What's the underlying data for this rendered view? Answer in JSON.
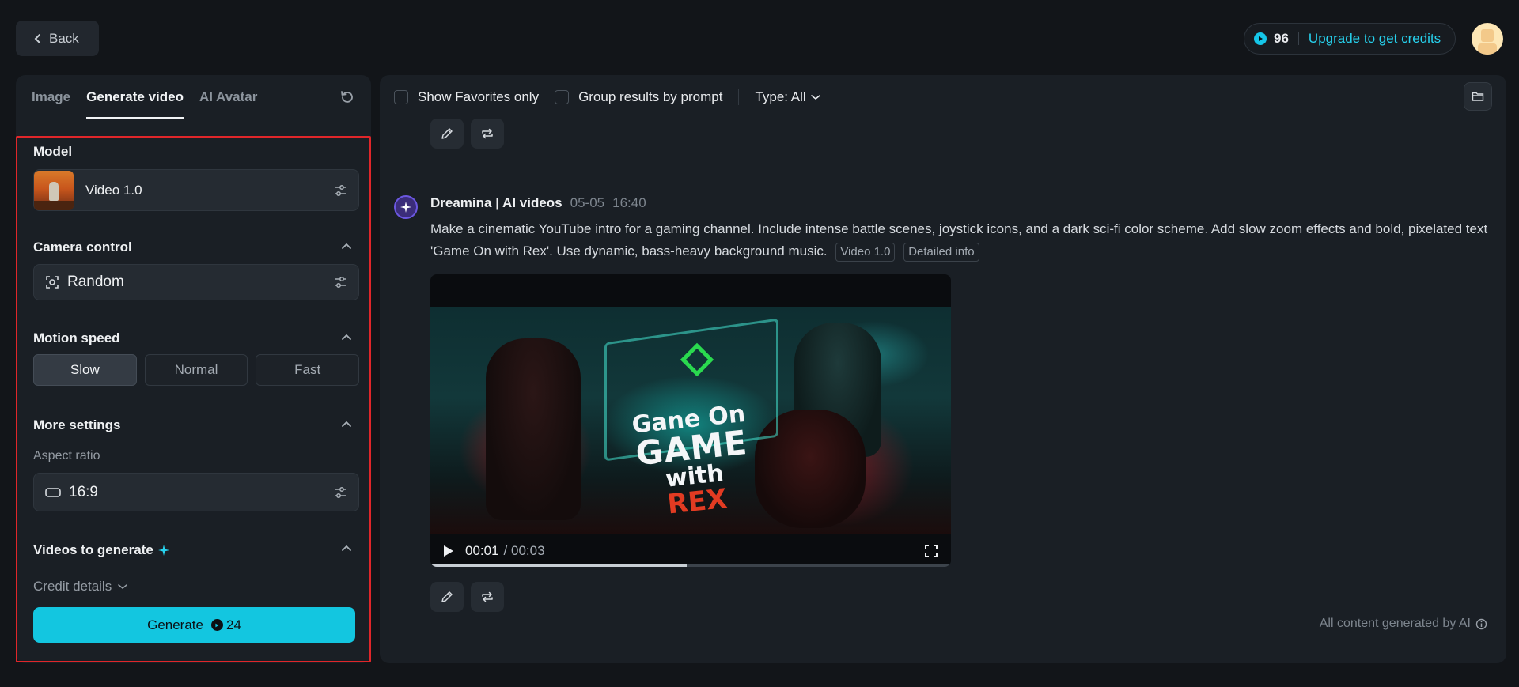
{
  "top": {
    "back_label": "Back",
    "credits_count": "96",
    "upgrade_label": "Upgrade to get credits"
  },
  "left": {
    "tabs": [
      {
        "label": "Image",
        "active": false
      },
      {
        "label": "Generate video",
        "active": true
      },
      {
        "label": "AI Avatar",
        "active": false
      }
    ],
    "model": {
      "title": "Model",
      "value": "Video 1.0"
    },
    "camera": {
      "title": "Camera control",
      "value": "Random"
    },
    "motion": {
      "title": "Motion speed",
      "options": [
        "Slow",
        "Normal",
        "Fast"
      ],
      "selected": "Slow"
    },
    "more": {
      "title": "More settings",
      "aspect_label": "Aspect ratio",
      "aspect_value": "16:9"
    },
    "videos_to_generate": "Videos to generate",
    "credit_details": "Credit details",
    "generate": {
      "label": "Generate",
      "cost": "24"
    }
  },
  "right": {
    "filters": {
      "favorites": "Show Favorites only",
      "group": "Group results by prompt",
      "type": "Type: All"
    },
    "post": {
      "author": "Dreamina | AI videos",
      "date": "05-05",
      "time": "16:40",
      "prompt": "Make a cinematic YouTube intro for a gaming channel. Include intense battle scenes, joystick icons, and a dark sci-fi color scheme. Add slow zoom effects and bold, pixelated text 'Game On with Rex'. Use dynamic, bass-heavy background music.",
      "tag_model": "Video 1.0",
      "tag_info": "Detailed info"
    },
    "video": {
      "overlay_line1": "Gane On",
      "overlay_line2": "GAME",
      "overlay_line3": "with",
      "overlay_line4": "REX",
      "current_time": "00:01",
      "duration": "/ 00:03",
      "progress": 0.4926
    },
    "footer_note": "All content generated by AI"
  },
  "colors": {
    "accent": "#13c6e0",
    "upgrade_text": "#27d3ef",
    "highlight_border": "#e0262a",
    "background": "#121519",
    "panel": "#1a1f25"
  },
  "icons": {
    "back": "chevron-left-icon",
    "credit": "credit-icon",
    "reset": "refresh-icon",
    "adjust": "sliders-icon",
    "camera": "camera-focus-icon",
    "aspect": "rectangle-icon",
    "sparkle": "sparkle-icon",
    "edit": "pencil-icon",
    "regenerate": "repeat-icon",
    "folder": "folder-icon",
    "play": "play-icon",
    "fullscreen": "fullscreen-icon",
    "info": "info-icon"
  }
}
